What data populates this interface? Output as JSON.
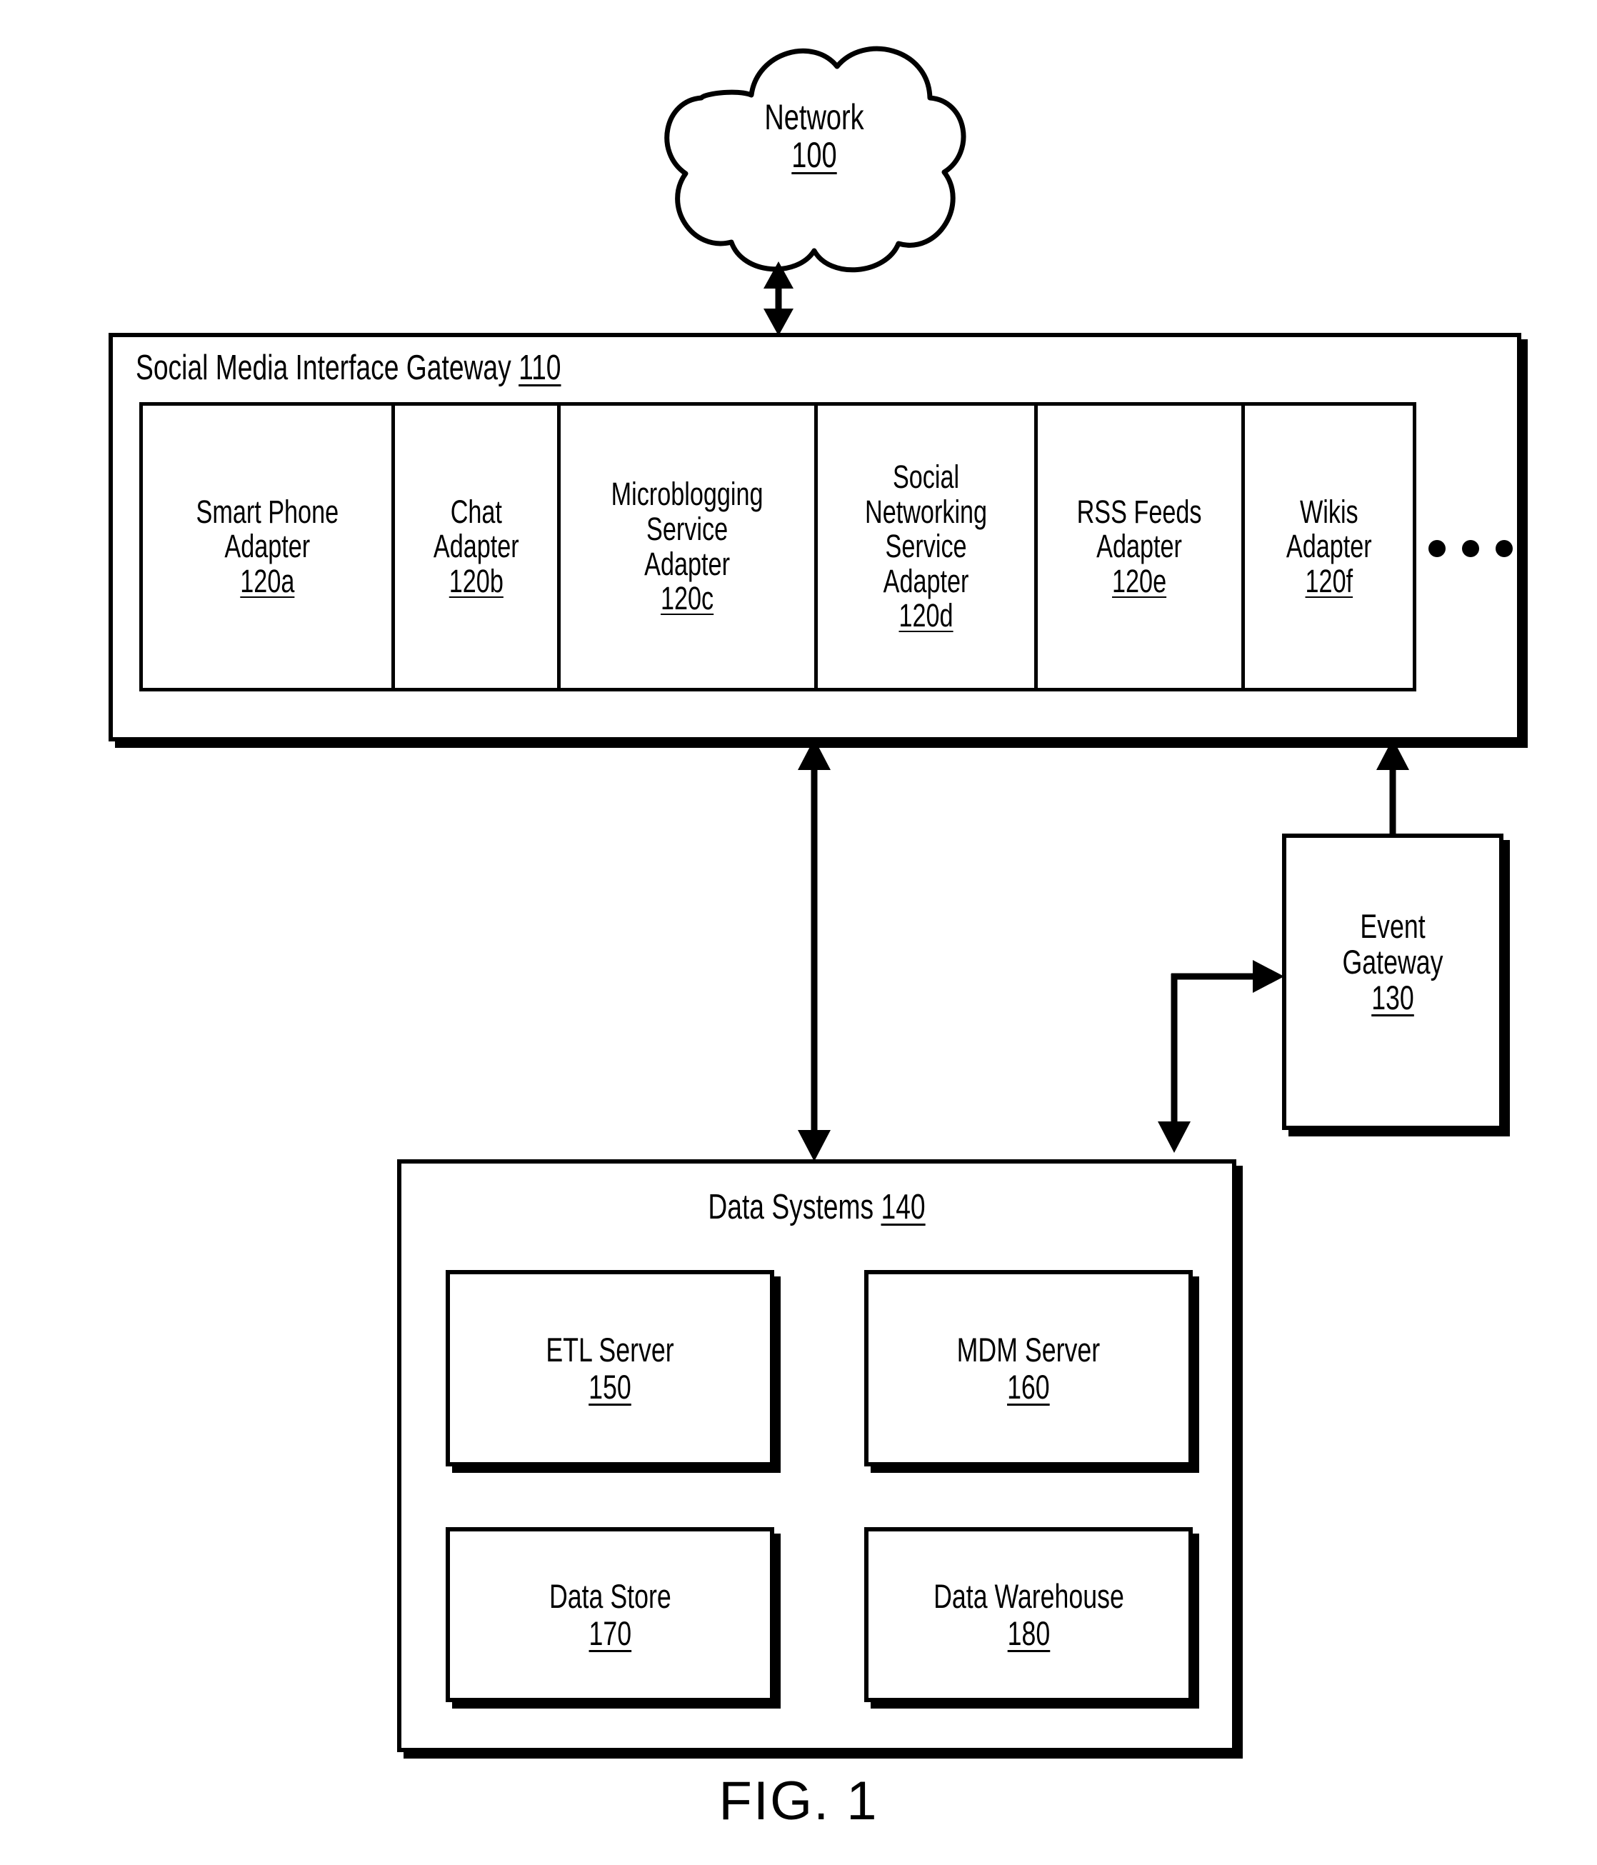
{
  "figure": {
    "caption": "FIG. 1",
    "type": "patent-block-diagram"
  },
  "network": {
    "name": "Network",
    "ref": "100",
    "shape": "cloud-icon"
  },
  "gateway": {
    "name": "Social Media Interface Gateway",
    "ref": "110",
    "ellipsis": "continues",
    "adapters": [
      {
        "name": "Smart Phone\nAdapter",
        "ref": "120a"
      },
      {
        "name": "Chat\nAdapter",
        "ref": "120b"
      },
      {
        "name": "Microblogging\nService\nAdapter",
        "ref": "120c"
      },
      {
        "name": "Social\nNetworking\nService\nAdapter",
        "ref": "120d"
      },
      {
        "name": "RSS Feeds\nAdapter",
        "ref": "120e"
      },
      {
        "name": "Wikis\nAdapter",
        "ref": "120f"
      }
    ]
  },
  "event_gateway": {
    "name": "Event\nGateway",
    "ref": "130"
  },
  "data_systems": {
    "name": "Data Systems",
    "ref": "140",
    "components": [
      {
        "name": "ETL Server",
        "ref": "150"
      },
      {
        "name": "MDM Server",
        "ref": "160"
      },
      {
        "name": "Data Store",
        "ref": "170"
      },
      {
        "name": "Data Warehouse",
        "ref": "180"
      }
    ]
  },
  "connections": [
    {
      "from": "Network 100",
      "to": "Social Media Interface Gateway 110",
      "arrow": "bidirectional"
    },
    {
      "from": "Social Media Interface Gateway 110",
      "to": "Data Systems 140",
      "arrow": "bidirectional"
    },
    {
      "from": "Event Gateway 130",
      "to": "Social Media Interface Gateway 110",
      "arrow": "up"
    },
    {
      "from": "Data Systems 140 branch",
      "to": "Event Gateway 130",
      "arrow": "right"
    },
    {
      "from": "Event Gateway 130 branch",
      "to": "Data Systems 140",
      "arrow": "down"
    }
  ],
  "style": {
    "stroke": "#000000",
    "background": "#ffffff"
  }
}
